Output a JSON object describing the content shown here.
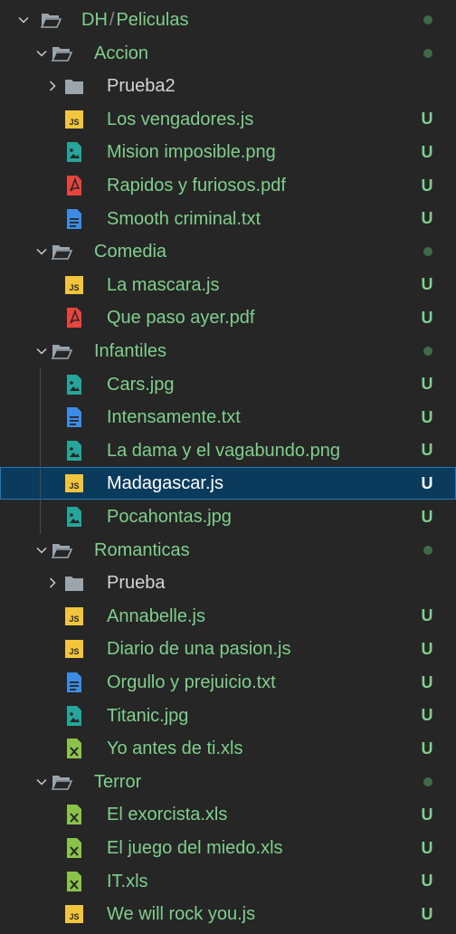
{
  "explorer": {
    "rows": [
      {
        "kind": "folder",
        "expanded": true,
        "depth": 0,
        "segments": [
          "DH",
          "Peliculas"
        ],
        "path_separator": "/",
        "marker": "dot",
        "color": "#7fcf8c"
      },
      {
        "kind": "folder",
        "expanded": true,
        "depth": 1,
        "label": "Accion",
        "marker": "dot"
      },
      {
        "kind": "folder",
        "expanded": false,
        "depth": 2,
        "label": "Prueba2",
        "marker": "none",
        "plain": true
      },
      {
        "kind": "file",
        "icon": "js",
        "depth": 2,
        "label": "Los vengadores.js",
        "status": "U"
      },
      {
        "kind": "file",
        "icon": "image",
        "depth": 2,
        "label": "Mision imposible.png",
        "status": "U"
      },
      {
        "kind": "file",
        "icon": "pdf",
        "depth": 2,
        "label": "Rapidos y furiosos.pdf",
        "status": "U"
      },
      {
        "kind": "file",
        "icon": "text",
        "depth": 2,
        "label": "Smooth criminal.txt",
        "status": "U"
      },
      {
        "kind": "folder",
        "expanded": true,
        "depth": 1,
        "label": "Comedia",
        "marker": "dot"
      },
      {
        "kind": "file",
        "icon": "js",
        "depth": 2,
        "label": "La mascara.js",
        "status": "U"
      },
      {
        "kind": "file",
        "icon": "pdf",
        "depth": 2,
        "label": "Que paso ayer.pdf",
        "status": "U"
      },
      {
        "kind": "folder",
        "expanded": true,
        "depth": 1,
        "label": "Infantiles",
        "marker": "dot"
      },
      {
        "kind": "file",
        "icon": "image",
        "depth": 2,
        "label": "Cars.jpg",
        "status": "U"
      },
      {
        "kind": "file",
        "icon": "text",
        "depth": 2,
        "label": "Intensamente.txt",
        "status": "U"
      },
      {
        "kind": "file",
        "icon": "image",
        "depth": 2,
        "label": "La dama y el vagabundo.png",
        "status": "U"
      },
      {
        "kind": "file",
        "icon": "js",
        "depth": 2,
        "label": "Madagascar.js",
        "status": "U",
        "selected": true
      },
      {
        "kind": "file",
        "icon": "image",
        "depth": 2,
        "label": "Pocahontas.jpg",
        "status": "U"
      },
      {
        "kind": "folder",
        "expanded": true,
        "depth": 1,
        "label": "Romanticas",
        "marker": "dot"
      },
      {
        "kind": "folder",
        "expanded": false,
        "depth": 2,
        "label": "Prueba",
        "marker": "none",
        "plain": true
      },
      {
        "kind": "file",
        "icon": "js",
        "depth": 2,
        "label": "Annabelle.js",
        "status": "U"
      },
      {
        "kind": "file",
        "icon": "js",
        "depth": 2,
        "label": "Diario de una pasion.js",
        "status": "U"
      },
      {
        "kind": "file",
        "icon": "text",
        "depth": 2,
        "label": "Orgullo y prejuicio.txt",
        "status": "U"
      },
      {
        "kind": "file",
        "icon": "image",
        "depth": 2,
        "label": "Titanic.jpg",
        "status": "U"
      },
      {
        "kind": "file",
        "icon": "excel",
        "depth": 2,
        "label": "Yo antes de ti.xls",
        "status": "U"
      },
      {
        "kind": "folder",
        "expanded": true,
        "depth": 1,
        "label": "Terror",
        "marker": "dot"
      },
      {
        "kind": "file",
        "icon": "excel",
        "depth": 2,
        "label": "El exorcista.xls",
        "status": "U"
      },
      {
        "kind": "file",
        "icon": "excel",
        "depth": 2,
        "label": "El juego del miedo.xls",
        "status": "U"
      },
      {
        "kind": "file",
        "icon": "excel",
        "depth": 2,
        "label": "IT.xls",
        "status": "U"
      },
      {
        "kind": "file",
        "icon": "js",
        "depth": 2,
        "label": "We will rock you.js",
        "status": "U"
      }
    ]
  },
  "colors": {
    "background": "#262626",
    "untracked_text": "#7fcf8c",
    "selection_bg": "#0a3a5c",
    "selection_border": "#1f78c1",
    "js_icon": "#f2c53d",
    "image_icon": "#26a69a",
    "pdf_icon": "#e8453c",
    "text_icon": "#3c8ce7",
    "excel_icon": "#8bc34a",
    "folder_icon": "#9aa5ad"
  }
}
